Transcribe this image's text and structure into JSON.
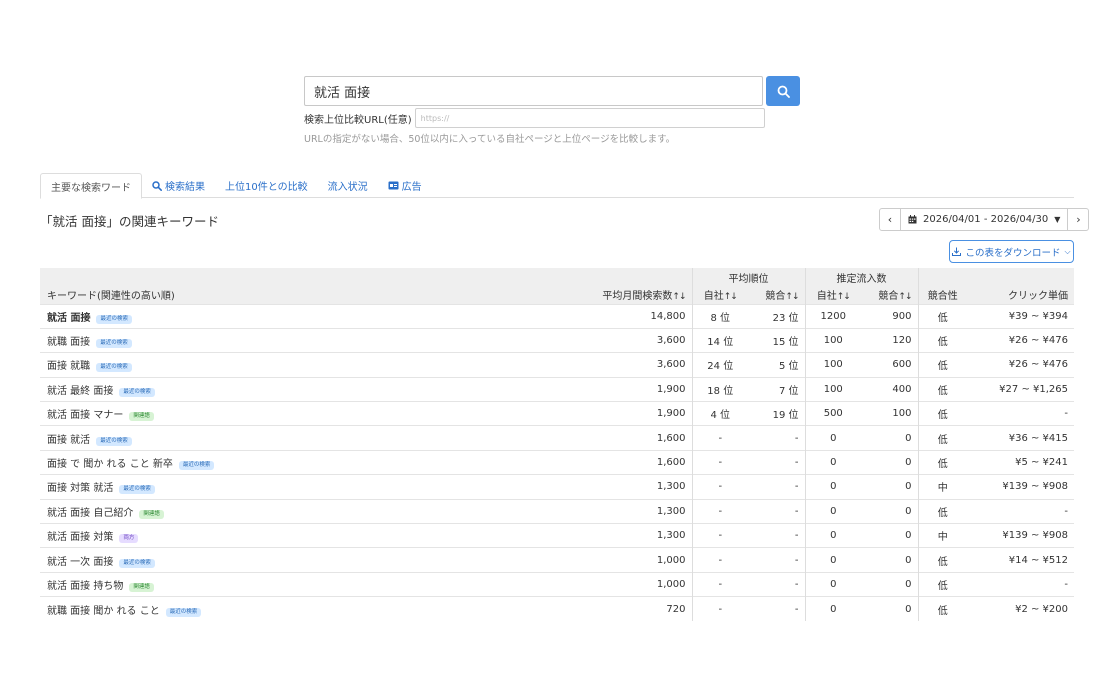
{
  "search": {
    "query": "就活 面接",
    "url_label": "検索上位比較URL(任意)",
    "url_placeholder": "https://",
    "hint": "URLの指定がない場合、50位以内に入っている自社ページと上位ページを比較します。"
  },
  "tabs": [
    {
      "label": "主要な検索ワード",
      "icon": ""
    },
    {
      "label": "検索結果",
      "icon": "search-icon"
    },
    {
      "label": "上位10件との比較",
      "icon": ""
    },
    {
      "label": "流入状況",
      "icon": ""
    },
    {
      "label": "広告",
      "icon": "ad-icon"
    }
  ],
  "section_title": "「就活 面接」の関連キーワード",
  "date_range": "2026/04/01 - 2026/04/30",
  "download_label": "この表をダウンロード",
  "table": {
    "group_headers": {
      "rank": "平均順位",
      "inflow": "推定流入数"
    },
    "headers": {
      "keyword": "キーワード(関連性の高い順)",
      "volume": "平均月間検索数",
      "rank_own": "自社",
      "rank_comp": "競合",
      "inflow_own": "自社",
      "inflow_comp": "競合",
      "competition": "競合性",
      "cpc": "クリック単価"
    },
    "sort_arrows": "↑↓",
    "rows": [
      {
        "keyword": "就活 面接",
        "badge": "最近の検索",
        "badge_type": "recent",
        "bold": true,
        "volume": "14,800",
        "rank_own": "8 位",
        "rank_comp": "23 位",
        "inflow_own": "1200",
        "inflow_comp": "900",
        "competition": "低",
        "cpc": "¥39 ~ ¥394"
      },
      {
        "keyword": "就職 面接",
        "badge": "最近の検索",
        "badge_type": "recent",
        "bold": false,
        "volume": "3,600",
        "rank_own": "14 位",
        "rank_comp": "15 位",
        "inflow_own": "100",
        "inflow_comp": "120",
        "competition": "低",
        "cpc": "¥26 ~ ¥476"
      },
      {
        "keyword": "面接 就職",
        "badge": "最近の検索",
        "badge_type": "recent",
        "bold": false,
        "volume": "3,600",
        "rank_own": "24 位",
        "rank_comp": "5 位",
        "inflow_own": "100",
        "inflow_comp": "600",
        "competition": "低",
        "cpc": "¥26 ~ ¥476"
      },
      {
        "keyword": "就活 最終 面接",
        "badge": "最近の検索",
        "badge_type": "recent",
        "bold": false,
        "volume": "1,900",
        "rank_own": "18 位",
        "rank_comp": "7 位",
        "inflow_own": "100",
        "inflow_comp": "400",
        "competition": "低",
        "cpc": "¥27 ~ ¥1,265"
      },
      {
        "keyword": "就活 面接 マナー",
        "badge": "関連語",
        "badge_type": "related",
        "bold": false,
        "volume": "1,900",
        "rank_own": "4 位",
        "rank_comp": "19 位",
        "inflow_own": "500",
        "inflow_comp": "100",
        "competition": "低",
        "cpc": "-"
      },
      {
        "keyword": "面接 就活",
        "badge": "最近の検索",
        "badge_type": "recent",
        "bold": false,
        "volume": "1,600",
        "rank_own": "-",
        "rank_comp": "-",
        "inflow_own": "0",
        "inflow_comp": "0",
        "competition": "低",
        "cpc": "¥36 ~ ¥415"
      },
      {
        "keyword": "面接 で 聞か れる こと 新卒",
        "badge": "最近の検索",
        "badge_type": "recent",
        "bold": false,
        "volume": "1,600",
        "rank_own": "-",
        "rank_comp": "-",
        "inflow_own": "0",
        "inflow_comp": "0",
        "competition": "低",
        "cpc": "¥5 ~ ¥241"
      },
      {
        "keyword": "面接 対策 就活",
        "badge": "最近の検索",
        "badge_type": "recent",
        "bold": false,
        "volume": "1,300",
        "rank_own": "-",
        "rank_comp": "-",
        "inflow_own": "0",
        "inflow_comp": "0",
        "competition": "中",
        "cpc": "¥139 ~ ¥908"
      },
      {
        "keyword": "就活 面接 自己紹介",
        "badge": "関連語",
        "badge_type": "related",
        "bold": false,
        "volume": "1,300",
        "rank_own": "-",
        "rank_comp": "-",
        "inflow_own": "0",
        "inflow_comp": "0",
        "competition": "低",
        "cpc": "-"
      },
      {
        "keyword": "就活 面接 対策",
        "badge": "両方",
        "badge_type": "other",
        "bold": false,
        "volume": "1,300",
        "rank_own": "-",
        "rank_comp": "-",
        "inflow_own": "0",
        "inflow_comp": "0",
        "competition": "中",
        "cpc": "¥139 ~ ¥908"
      },
      {
        "keyword": "就活 一次 面接",
        "badge": "最近の検索",
        "badge_type": "recent",
        "bold": false,
        "volume": "1,000",
        "rank_own": "-",
        "rank_comp": "-",
        "inflow_own": "0",
        "inflow_comp": "0",
        "competition": "低",
        "cpc": "¥14 ~ ¥512"
      },
      {
        "keyword": "就活 面接 持ち物",
        "badge": "関連語",
        "badge_type": "related",
        "bold": false,
        "volume": "1,000",
        "rank_own": "-",
        "rank_comp": "-",
        "inflow_own": "0",
        "inflow_comp": "0",
        "competition": "低",
        "cpc": "-"
      },
      {
        "keyword": "就職 面接 聞か れる こと",
        "badge": "最近の検索",
        "badge_type": "recent",
        "bold": false,
        "volume": "720",
        "rank_own": "-",
        "rank_comp": "-",
        "inflow_own": "0",
        "inflow_comp": "0",
        "competition": "低",
        "cpc": "¥2 ~ ¥200"
      }
    ]
  },
  "colors": {
    "accent": "#4a90e2",
    "link": "#2a6fc9",
    "header_bg": "#efefef"
  }
}
